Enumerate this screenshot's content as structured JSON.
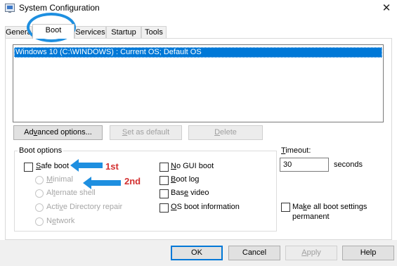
{
  "window": {
    "title": "System Configuration",
    "close_glyph": "✕"
  },
  "tabs": [
    {
      "label": "General"
    },
    {
      "label": "Boot"
    },
    {
      "label": "Services"
    },
    {
      "label": "Startup"
    },
    {
      "label": "Tools"
    }
  ],
  "os_list": {
    "items": [
      "Windows 10 (C:\\WINDOWS) : Current OS; Default OS"
    ]
  },
  "os_buttons": {
    "advanced_pre": "Ad",
    "advanced_u": "v",
    "advanced_post": "anced options...",
    "set_default_pre": "",
    "set_default_u": "S",
    "set_default_post": "et as default",
    "delete_pre": "",
    "delete_u": "D",
    "delete_post": "elete"
  },
  "boot_options": {
    "group_label": "Boot options",
    "safe_boot_pre": "",
    "safe_boot_u": "S",
    "safe_boot_post": "afe boot",
    "minimal_pre": "",
    "minimal_u": "M",
    "minimal_post": "inimal",
    "alternate_pre": "Al",
    "alternate_u": "t",
    "alternate_post": "ernate shell",
    "ad_pre": "Acti",
    "ad_u": "v",
    "ad_post": "e Directory repair",
    "network_pre": "N",
    "network_u": "e",
    "network_post": "twork",
    "no_gui_pre": "",
    "no_gui_u": "N",
    "no_gui_post": "o GUI boot",
    "boot_log_pre": "",
    "boot_log_u": "B",
    "boot_log_post": "oot log",
    "base_video_pre": "Bas",
    "base_video_u": "e",
    "base_video_post": " video",
    "os_info_pre": "",
    "os_info_u": "O",
    "os_info_post": "S boot information"
  },
  "timeout": {
    "label_pre": "",
    "label_u": "T",
    "label_post": "imeout:",
    "value": "30",
    "unit": "seconds"
  },
  "permanent": {
    "line1_pre": "Ma",
    "line1_u": "k",
    "line1_post": "e all boot settings",
    "line2": "permanent"
  },
  "footer": {
    "ok": "OK",
    "cancel": "Cancel",
    "apply_pre": "",
    "apply_u": "A",
    "apply_post": "pply",
    "help": "Help"
  },
  "annotations": {
    "first": "1st",
    "second": "2nd"
  },
  "colors": {
    "accent": "#0078d7",
    "annotation_blue": "#1e8fe0",
    "annotation_red": "#d32f2f"
  }
}
